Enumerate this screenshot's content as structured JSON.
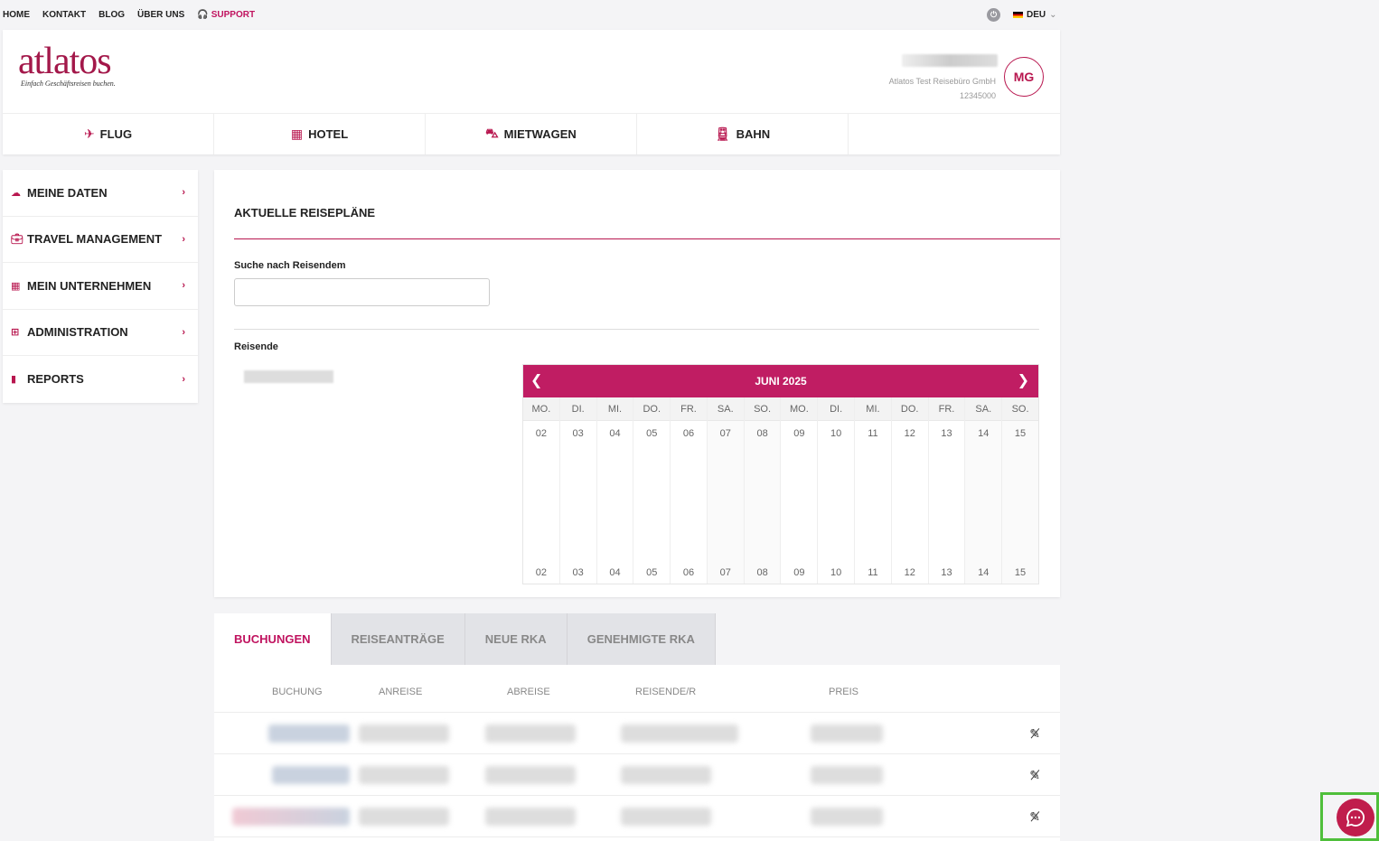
{
  "topbar": {
    "links": [
      "HOME",
      "KONTAKT",
      "BLOG",
      "ÜBER UNS"
    ],
    "support": "SUPPORT",
    "language": "DEU"
  },
  "header": {
    "logo_text": "atlatos",
    "logo_tagline": "Einfach Geschäftsreisen buchen.",
    "agency_name": "Atlatos Test Reisebüro GmbH",
    "agency_number": "12345000",
    "avatar_initials": "MG"
  },
  "nav": [
    {
      "label": "FLUG",
      "icon": "plane-icon"
    },
    {
      "label": "HOTEL",
      "icon": "building-icon"
    },
    {
      "label": "MIETWAGEN",
      "icon": "car-icon"
    },
    {
      "label": "BAHN",
      "icon": "train-icon"
    }
  ],
  "sidebar": [
    {
      "label": "MEINE DATEN",
      "icon": "cloud-icon"
    },
    {
      "label": "TRAVEL MANAGEMENT",
      "icon": "briefcase-icon"
    },
    {
      "label": "MEIN UNTERNEHMEN",
      "icon": "building-icon"
    },
    {
      "label": "ADMINISTRATION",
      "icon": "sitemap-icon"
    },
    {
      "label": "REPORTS",
      "icon": "bar-chart-icon"
    }
  ],
  "plans": {
    "title": "AKTUELLE REISEPLÄNE",
    "search_label": "Suche nach Reisendem",
    "search_value": "",
    "travelers_label": "Reisende"
  },
  "calendar": {
    "month": "JUNI 2025",
    "days": [
      {
        "dow": "MO.",
        "date": "02"
      },
      {
        "dow": "DI.",
        "date": "03"
      },
      {
        "dow": "MI.",
        "date": "04"
      },
      {
        "dow": "DO.",
        "date": "05"
      },
      {
        "dow": "FR.",
        "date": "06"
      },
      {
        "dow": "SA.",
        "date": "07"
      },
      {
        "dow": "SO.",
        "date": "08"
      },
      {
        "dow": "MO.",
        "date": "09"
      },
      {
        "dow": "DI.",
        "date": "10"
      },
      {
        "dow": "MI.",
        "date": "11"
      },
      {
        "dow": "DO.",
        "date": "12"
      },
      {
        "dow": "FR.",
        "date": "13"
      },
      {
        "dow": "SA.",
        "date": "14"
      },
      {
        "dow": "SO.",
        "date": "15"
      }
    ]
  },
  "tabs": [
    "BUCHUNGEN",
    "REISEANTRÄGE",
    "NEUE RKA",
    "GENEHMIGTE RKA"
  ],
  "table": {
    "columns": [
      "BUCHUNG",
      "ANREISE",
      "ABREISE",
      "REISENDE/R",
      "PREIS"
    ]
  },
  "colors": {
    "accent": "#c01d63",
    "brand": "#a3184a",
    "chat_button": "#c01d4c",
    "highlight": "#4fbf3b"
  }
}
